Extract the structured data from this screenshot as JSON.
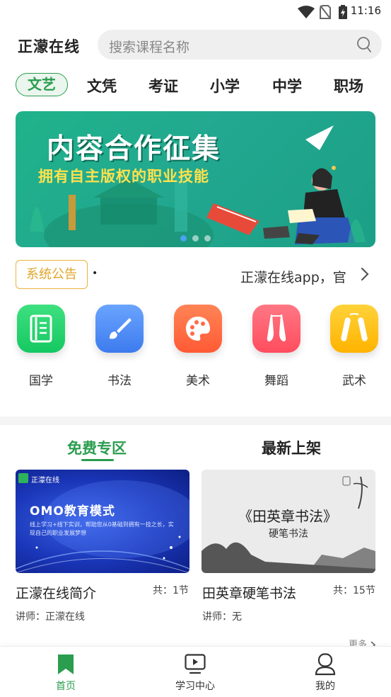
{
  "status_bar": {
    "time": "11:16"
  },
  "header": {
    "brand": "正濛在线",
    "search_placeholder": "搜索课程名称"
  },
  "category_tabs": [
    "文艺",
    "文凭",
    "考证",
    "小学",
    "中学",
    "职场"
  ],
  "banner": {
    "title": "内容合作征集",
    "subtitle": "拥有自主版权的职业技能",
    "page_count": 3,
    "active_index": 0
  },
  "notice": {
    "badge": "系统公告",
    "bullet": "•",
    "text": "正濛在线app，官"
  },
  "categories": [
    {
      "label": "国学",
      "icon": "book-icon",
      "color": "#1fd26e"
    },
    {
      "label": "书法",
      "icon": "brush-icon",
      "color": "#4d8bf5"
    },
    {
      "label": "美术",
      "icon": "palette-icon",
      "color": "#ff6a45"
    },
    {
      "label": "舞蹈",
      "icon": "ballet-shoes-icon",
      "color": "#ff5a6a"
    },
    {
      "label": "武术",
      "icon": "nunchaku-icon",
      "color": "#ffc21a"
    }
  ],
  "sections": {
    "tabs": [
      "免费专区",
      "最新上架"
    ],
    "active": 0
  },
  "courses": [
    {
      "title": "正濛在线简介",
      "count": "共：1节",
      "teacher": "讲师：正濛在线",
      "cover": {
        "logo": "正濛在线",
        "headline": "OMO教育模式",
        "desc": "线上学习+线下实训，帮助您从0基础到拥有一技之长，实现自己的职业发展梦想"
      }
    },
    {
      "title": "田英章硬笔书法",
      "count": "共：15节",
      "teacher": "讲师：无",
      "cover": {
        "headline": "《田英章书法》",
        "sub": "硬笔书法"
      }
    }
  ],
  "more_label": "更多",
  "bottom_nav": [
    {
      "label": "首页",
      "icon": "bookmark-icon",
      "active": true
    },
    {
      "label": "学习中心",
      "icon": "video-play-icon",
      "active": false
    },
    {
      "label": "我的",
      "icon": "user-icon",
      "active": false
    }
  ],
  "colors": {
    "accent": "#2a9d4e",
    "notice": "#e0a628"
  }
}
